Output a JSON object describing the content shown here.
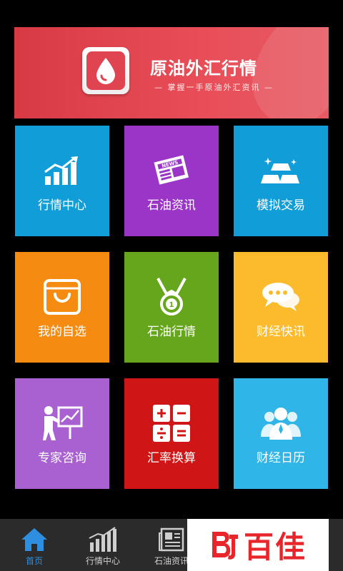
{
  "banner": {
    "title": "原油外汇行情",
    "subtitle": "— 掌握一手原油外汇资讯 —",
    "accent": "#d83a44"
  },
  "tiles": [
    {
      "label": "行情中心",
      "icon": "rising-chart-icon",
      "color": "#119ed8"
    },
    {
      "label": "石油资讯",
      "icon": "newspaper-icon",
      "color": "#9a35c7"
    },
    {
      "label": "模拟交易",
      "icon": "gold-bars-icon",
      "color": "#119ed8"
    },
    {
      "label": "我的自选",
      "icon": "shopping-bag-icon",
      "color": "#f68b12"
    },
    {
      "label": "石油行情",
      "icon": "medal-icon",
      "color": "#66a61c"
    },
    {
      "label": "财经快讯",
      "icon": "chat-bubbles-icon",
      "color": "#fbbb2c"
    },
    {
      "label": "专家咨询",
      "icon": "presenter-icon",
      "color": "#a960d1"
    },
    {
      "label": "汇率换算",
      "icon": "calculator-icon",
      "color": "#cf1515"
    },
    {
      "label": "财经日历",
      "icon": "people-group-icon",
      "color": "#2fb5e7"
    }
  ],
  "tabbar": {
    "items": [
      {
        "label": "首页",
        "icon": "home-icon",
        "active": true
      },
      {
        "label": "行情中心",
        "icon": "bar-chart-icon",
        "active": false
      },
      {
        "label": "石油资讯",
        "icon": "news-icon",
        "active": false
      }
    ],
    "active_color": "#2e8fe0"
  },
  "watermark": {
    "text": "百佳"
  }
}
